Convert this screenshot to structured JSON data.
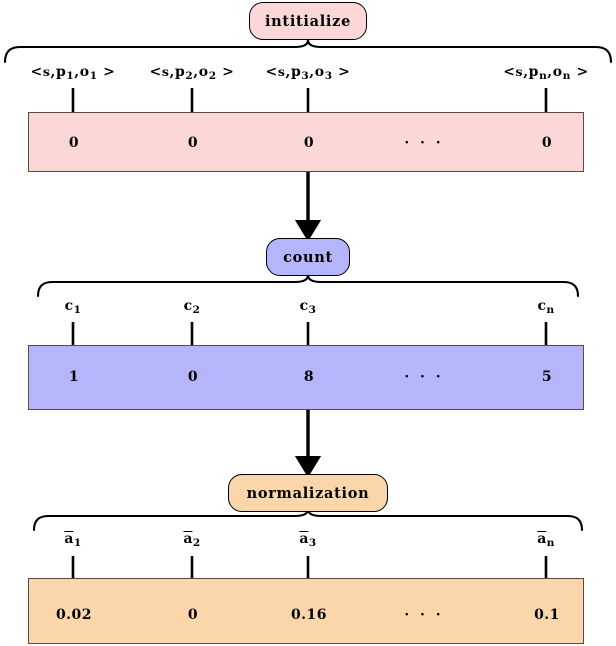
{
  "diagram": {
    "title": "intitialize-count-normalization pipeline",
    "colors": {
      "pink": "#fcd7d7",
      "blue": "#b5b5fb",
      "orange": "#fbd6ab",
      "stroke": "#000000",
      "row_border": "#5a4a45"
    },
    "stages": [
      {
        "node_label": "intitialize",
        "labels": [
          "< s , p1 , o1 >",
          "< s , p2 , o2 >",
          "< s , p3 , o3 >",
          "< s , pn , on >"
        ],
        "values": [
          "0",
          "0",
          "0",
          "0"
        ],
        "ellipsis": "· · ·"
      },
      {
        "node_label": "count",
        "labels": [
          "c1",
          "c2",
          "c3",
          "cn"
        ],
        "values": [
          "1",
          "0",
          "8",
          "5"
        ],
        "ellipsis": "· · ·"
      },
      {
        "node_label": "normalization",
        "labels": [
          "a1",
          "a2",
          "a3",
          "an"
        ],
        "values": [
          "0.02",
          "0",
          "0.16",
          "0.1"
        ],
        "ellipsis": "· · ·"
      }
    ],
    "triples": {
      "t1": {
        "subject": "s",
        "predicate": "p",
        "object": "o",
        "index": "1"
      },
      "t2": {
        "subject": "s",
        "predicate": "p",
        "object": "o",
        "index": "2"
      },
      "t3": {
        "subject": "s",
        "predicate": "p",
        "object": "o",
        "index": "3"
      },
      "tn": {
        "subject": "s",
        "predicate": "p",
        "object": "o",
        "index": "n"
      }
    },
    "count_labels": {
      "c1": "c",
      "c2": "c",
      "c3": "c",
      "cn": "c",
      "i1": "1",
      "i2": "2",
      "i3": "3",
      "in": "n"
    },
    "norm_labels": {
      "a1": "a",
      "a2": "a",
      "a3": "a",
      "an": "a",
      "i1": "1",
      "i2": "2",
      "i3": "3",
      "in": "n"
    },
    "init_values": {
      "v1": "0",
      "v2": "0",
      "v3": "0",
      "vn": "0",
      "dots": "· · ·"
    },
    "count_values": {
      "v1": "1",
      "v2": "0",
      "v3": "8",
      "vn": "5",
      "dots": "· · ·"
    },
    "norm_values": {
      "v1": "0.02",
      "v2": "0",
      "v3": "0.16",
      "vn": "0.1",
      "dots": "· · ·"
    },
    "nodes": {
      "initialize": "intitialize",
      "count": "count",
      "normalization": "normalization"
    },
    "punct": {
      "lt": "<",
      "gt": ">",
      "comma": ","
    }
  }
}
